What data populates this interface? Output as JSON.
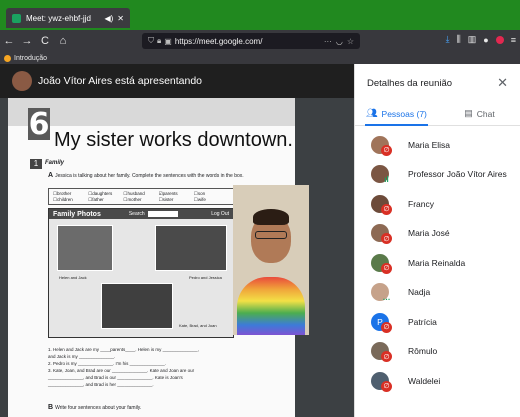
{
  "browser": {
    "tab_title": "Meet: ywz-ehbf-jjd",
    "tab_audio": "◀)",
    "tab_close": "✕",
    "back": "←",
    "forward": "→",
    "reload": "C",
    "home": "⌂",
    "url": "https://meet.google.com/",
    "url_more": "···",
    "bookmark_label": "Introdução"
  },
  "meet": {
    "presenter_text": "João Vítor Aires está apresentando"
  },
  "book": {
    "chapter_number": "6",
    "title": "My sister works downtown.",
    "section_number": "1",
    "section_label": "Family",
    "instruction_letter": "A",
    "instruction": "Jessica is talking about her family. Complete the sentences with the words in the box.",
    "words": [
      "brother",
      "daughters",
      "husband",
      "parents",
      "son",
      "children",
      "father",
      "mother",
      "sister",
      "wife"
    ],
    "checked_word": "parents",
    "photos_title": "Family Photos",
    "photos_search": "Search",
    "photos_logout": "Log Out",
    "captions": [
      "Helen and Jack",
      "Pedro and Jessica",
      "Kate, Brad, and Joan"
    ],
    "lines": [
      "1.  Helen and Jack are my ____parents____. Helen is my ______________,",
      "     and Jack is my ______________.",
      "2.  Pedro is my ______________. I'm his ______________.",
      "3.  Kate, Joan, and Brad are our ______________. Kate and Joan are our",
      "     ______________, and Brad is our ______________. Kate is Joan's",
      "     ______________, and Brad is her ______________."
    ],
    "secB_letter": "B",
    "secB_text": "Write four sentences about your family."
  },
  "panel": {
    "title": "Detalhes da reunião",
    "close": "✕",
    "tab_people": "Pessoas (7)",
    "tab_chat": "Chat",
    "participants": [
      {
        "name": "Maria Elisa",
        "color": "#a0745a",
        "muted": true
      },
      {
        "name": "Professor João Vítor Aires",
        "color": "#7b5643",
        "muted": false
      },
      {
        "name": "Francy",
        "color": "#6d4b3a",
        "muted": true
      },
      {
        "name": "Maria José",
        "color": "#8d6a54",
        "muted": true
      },
      {
        "name": "Maria Reinalda",
        "color": "#5a7a4a",
        "muted": true
      },
      {
        "name": "Nadja",
        "color": "#c6a28a",
        "muted": false
      },
      {
        "name": "Patrícia",
        "color": "#1a73e8",
        "muted": true,
        "initial": "P"
      },
      {
        "name": "Rômulo",
        "color": "#7a6a5a",
        "muted": true
      },
      {
        "name": "Waldelei",
        "color": "#4f5f6f",
        "muted": true
      }
    ]
  },
  "colors": {
    "tabbar": "#21891f",
    "accent": "#1a73e8",
    "muted_red": "#d93025"
  }
}
